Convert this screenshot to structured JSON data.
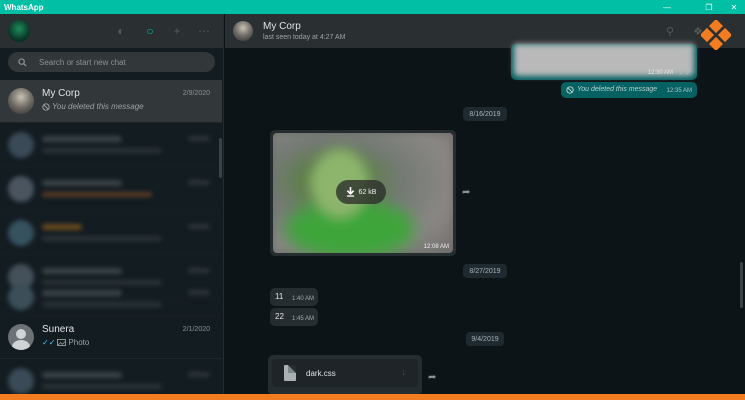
{
  "app": {
    "title": "WhatsApp"
  },
  "sidebar": {
    "search_placeholder": "Search or start new chat",
    "chats": [
      {
        "name": "My Corp",
        "date": "2/9/2020",
        "preview": "You deleted this message",
        "active": true
      },
      {
        "name": "Sunera",
        "date": "2/1/2020",
        "preview": "Photo",
        "active": false
      }
    ]
  },
  "conversation": {
    "contact_name": "My Corp",
    "status": "last seen today at 4:27 AM",
    "messages": [
      {
        "kind": "image-out",
        "time": "12:30 AM"
      },
      {
        "kind": "deleted-out",
        "text": "You deleted this message",
        "time": "12:35 AM"
      },
      {
        "kind": "date",
        "text": "8/16/2019"
      },
      {
        "kind": "image-in",
        "download_size": "62 kB",
        "time": "12:08 AM"
      },
      {
        "kind": "date",
        "text": "8/27/2019"
      },
      {
        "kind": "text-in",
        "text": "11",
        "time": "1:40 AM"
      },
      {
        "kind": "text-in",
        "text": "22",
        "time": "1:45 AM"
      },
      {
        "kind": "date",
        "text": "9/4/2019"
      },
      {
        "kind": "file-in",
        "filename": "dark.css"
      }
    ]
  },
  "colors": {
    "titlebar": "#00bfa5",
    "outgoing_bubble": "#056162",
    "incoming_bubble": "#262d31",
    "accent_orange": "#f47c20"
  }
}
